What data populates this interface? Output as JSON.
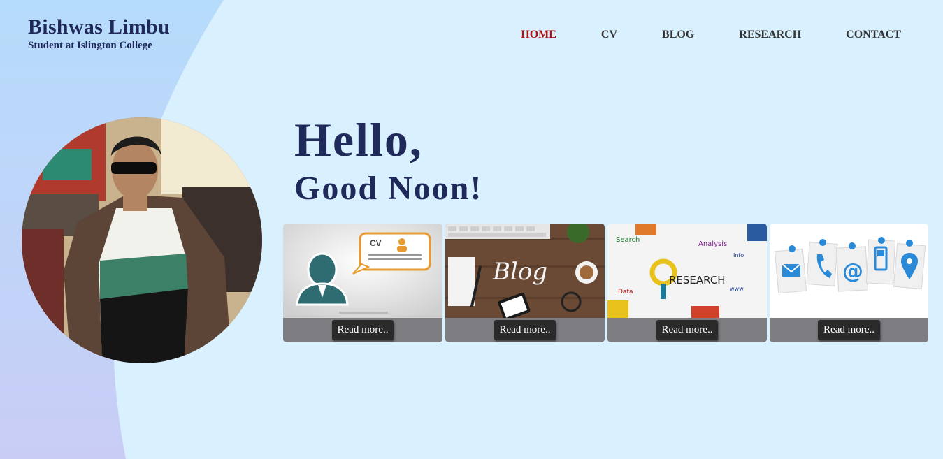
{
  "brand": {
    "name": "Bishwas Limbu",
    "subtitle": "Student at Islington College"
  },
  "nav": {
    "items": [
      {
        "label": "HOME",
        "active": true
      },
      {
        "label": "CV",
        "active": false
      },
      {
        "label": "BLOG",
        "active": false
      },
      {
        "label": "RESEARCH",
        "active": false
      },
      {
        "label": "CONTACT",
        "active": false
      }
    ]
  },
  "hero": {
    "greeting": "Hello,",
    "time_greeting": "Good Noon!"
  },
  "cards": [
    {
      "image_label": "CV",
      "button_label": "Read more.."
    },
    {
      "image_label": "Blog",
      "button_label": "Read more.."
    },
    {
      "image_label": "RESEARCH",
      "button_label": "Read more.."
    },
    {
      "image_label": "",
      "button_label": "Read more.."
    }
  ],
  "colors": {
    "background": "#d9f0fe",
    "accent_text": "#1f2a5a",
    "active_nav": "#b01010",
    "card_footer": "#7d7d82",
    "button": "#2a2a2a"
  }
}
